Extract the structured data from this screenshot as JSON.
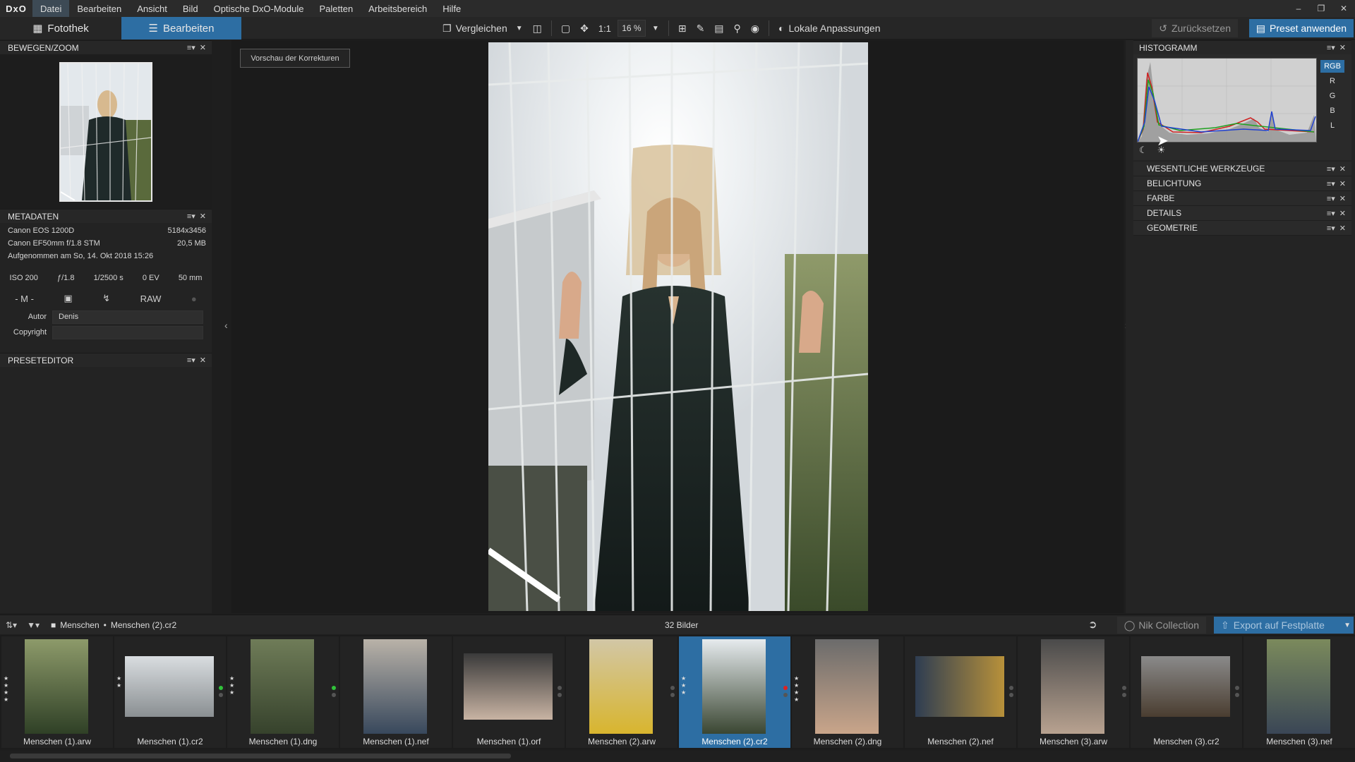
{
  "app": {
    "logo": "DxO"
  },
  "menu": [
    "Datei",
    "Bearbeiten",
    "Ansicht",
    "Bild",
    "Optische DxO-Module",
    "Paletten",
    "Arbeitsbereich",
    "Hilfe"
  ],
  "toolbar": {
    "library_tab": "Fotothek",
    "edit_tab": "Bearbeiten",
    "compare_label": "Vergleichen",
    "one_to_one": "1:1",
    "zoom": "16 %",
    "local_adjust": "Lokale Anpassungen",
    "reset": "Zurücksetzen",
    "apply_preset": "Preset anwenden"
  },
  "left": {
    "navigator_title": "BEWEGEN/ZOOM",
    "metadata_title": "METADATEN",
    "camera": "Canon EOS 1200D",
    "resolution": "5184x3456",
    "lens": "Canon EF50mm f/1.8 STM",
    "filesize": "20,5 MB",
    "taken": "Aufgenommen am So, 14. Okt 2018 15:26",
    "iso": "ISO 200",
    "aperture": "ƒ/1.8",
    "shutter": "1/2500 s",
    "ev": "0 EV",
    "focal": "50 mm",
    "mode": "- M -",
    "format": "RAW",
    "author_label": "Autor",
    "author_value": "Denis",
    "copyright_label": "Copyright",
    "copyright_value": "",
    "preset_title": "PRESETEDITOR"
  },
  "viewer": {
    "preview_button": "Vorschau der Korrekturen"
  },
  "right": {
    "histogram_title": "HISTOGRAMM",
    "channels": [
      "RGB",
      "R",
      "G",
      "B",
      "L"
    ],
    "sections": [
      "WESENTLICHE WERKZEUGE",
      "BELICHTUNG",
      "FARBE",
      "DETAILS",
      "GEOMETRIE"
    ]
  },
  "filmbar": {
    "folder": "Menschen",
    "separator": "•",
    "file": "Menschen (2).cr2",
    "count": "32 Bilder",
    "nik": "Nik Collection",
    "export": "Export auf Festplatte"
  },
  "film_items": [
    {
      "name": "Menschen (1).arw"
    },
    {
      "name": "Menschen (1).cr2"
    },
    {
      "name": "Menschen (1).dng"
    },
    {
      "name": "Menschen (1).nef"
    },
    {
      "name": "Menschen (1).orf"
    },
    {
      "name": "Menschen (2).arw"
    },
    {
      "name": "Menschen (2).cr2"
    },
    {
      "name": "Menschen (2).dng"
    },
    {
      "name": "Menschen (2).nef"
    },
    {
      "name": "Menschen (3).arw"
    },
    {
      "name": "Menschen (3).cr2"
    },
    {
      "name": "Menschen (3).nef"
    }
  ],
  "colors": {
    "accent": "#2d6ea3",
    "panel": "#232323",
    "viewer_bg": "#1b1b1b"
  }
}
